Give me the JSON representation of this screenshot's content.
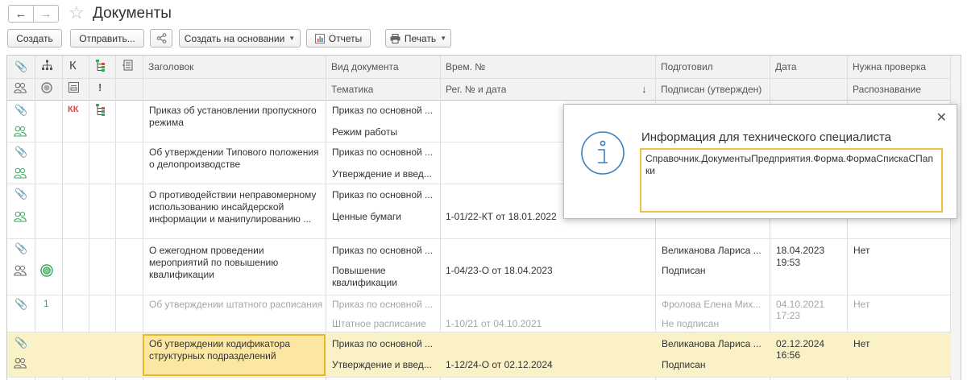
{
  "header": {
    "title": "Документы",
    "back_icon": "arrow-left-icon",
    "forward_icon": "arrow-right-icon",
    "favorite_icon": "star-icon"
  },
  "toolbar": {
    "create": "Создать",
    "send": "Отправить...",
    "create_based": "Создать на основании",
    "reports": "Отчеты",
    "print": "Печать"
  },
  "columns": {
    "title": "Заголовок",
    "doc_type": "Вид документа",
    "topic": "Тематика",
    "temp_no": "Врем. №",
    "reg_no": "Рег. № и дата",
    "sort_arrow": "↓",
    "prepared": "Подготовил",
    "signed": "Подписан (утвержден)",
    "date": "Дата",
    "check": "Нужна проверка",
    "recognition": "Распознавание",
    "k": "К"
  },
  "rows": [
    {
      "title": "Приказ об установлении пропускного режима",
      "doc_type": "Приказ по основной ...",
      "topic": "Режим работы",
      "reg": "",
      "prepared": "",
      "signed": "",
      "date": "",
      "time": "",
      "check": "",
      "k_mark": "КК"
    },
    {
      "title": "Об утверждении Типового положения о делопроизводстве",
      "doc_type": "Приказ по основной ...",
      "topic": "Утверждение и введ...",
      "reg": "",
      "prepared": "",
      "signed": "",
      "date": "",
      "time": "",
      "check": ""
    },
    {
      "title": "О противодействии неправомерному использованию инсайдерской информации и манипулированию ...",
      "doc_type": "Приказ по основной ...",
      "topic": "Ценные бумаги",
      "reg": "1-01/22-КТ от 18.01.2022",
      "prepared": "",
      "signed": "",
      "date": "",
      "time": "",
      "check": ""
    },
    {
      "title": "О ежегодном проведении мероприятий по повышению квалификации",
      "doc_type": "Приказ по основной ...",
      "topic": "Повышение квалификации",
      "reg": "1-04/23-О от 18.04.2023",
      "prepared": "Великанова Лариса ...",
      "signed": "Подписан",
      "date": "18.04.2023",
      "time": "19:53",
      "check": "Нет"
    },
    {
      "title": "Об утверждении штатного расписания",
      "doc_type": "Приказ по основной ...",
      "topic": "Штатное расписание",
      "reg": "1-10/21 от 04.10.2021",
      "prepared": "Фролова Елена Мих...",
      "signed": "Не подписан",
      "date": "04.10.2021",
      "time": "17:23",
      "check": "Нет",
      "k_mark": "1"
    },
    {
      "title": "Об утверждении кодификатора структурных подразделений",
      "doc_type": "Приказ по основной ...",
      "topic": "Утверждение и введ...",
      "reg": "1-12/24-О от 02.12.2024",
      "prepared": "Великанова Лариса ...",
      "signed": "Подписан",
      "date": "02.12.2024",
      "time": "16:56",
      "check": "Нет"
    }
  ],
  "popup": {
    "title": "Информация для технического специалиста",
    "content": "Справочник.ДокументыПредприятия.Форма.ФормаСпискаСПапки",
    "close_icon": "close-icon",
    "info_icon": "info-icon"
  }
}
